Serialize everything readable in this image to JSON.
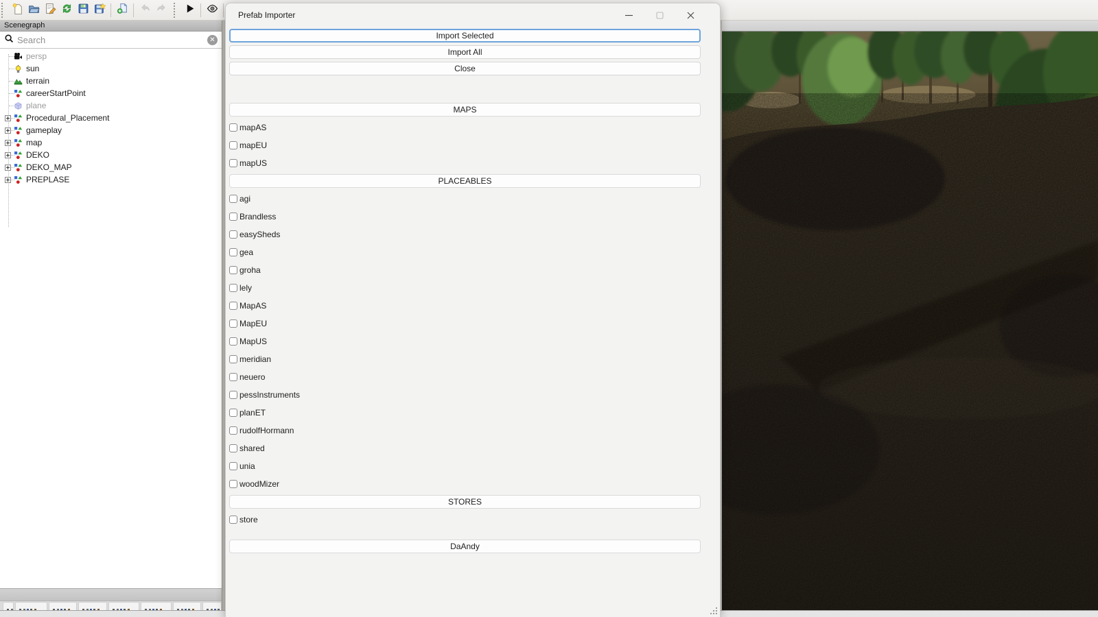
{
  "toolbar": {
    "icons": [
      "new-file",
      "open-file",
      "edit-script",
      "refresh",
      "save",
      "save-as",
      "import-file",
      "undo",
      "redo",
      "play",
      "toggle-visibility",
      "search"
    ]
  },
  "scenegraph": {
    "title": "Scenegraph",
    "search_placeholder": "Search",
    "tree": [
      {
        "label": "persp",
        "icon": "camera",
        "dim": true,
        "expandable": false
      },
      {
        "label": "sun",
        "icon": "light",
        "dim": false,
        "expandable": false
      },
      {
        "label": "terrain",
        "icon": "terrain",
        "dim": false,
        "expandable": false
      },
      {
        "label": "careerStartPoint",
        "icon": "transform-group",
        "dim": false,
        "expandable": false
      },
      {
        "label": "plane",
        "icon": "cube",
        "dim": true,
        "expandable": false
      },
      {
        "label": "Procedural_Placement",
        "icon": "transform-group",
        "dim": false,
        "expandable": true
      },
      {
        "label": "gameplay",
        "icon": "transform-group",
        "dim": false,
        "expandable": true
      },
      {
        "label": "map",
        "icon": "transform-group",
        "dim": false,
        "expandable": true
      },
      {
        "label": "DEKO",
        "icon": "transform-group",
        "dim": false,
        "expandable": true
      },
      {
        "label": "DEKO_MAP",
        "icon": "transform-group",
        "dim": false,
        "expandable": true
      },
      {
        "label": "PREPLASE",
        "icon": "transform-group",
        "dim": false,
        "expandable": true
      }
    ]
  },
  "dialog": {
    "title": "Prefab Importer",
    "window_controls": {
      "minimize": "–",
      "maximize": "",
      "close": "✕"
    },
    "buttons": {
      "import_selected": "Import Selected",
      "import_all": "Import All",
      "close": "Close"
    },
    "sections": {
      "maps": {
        "header": "MAPS",
        "items": [
          "mapAS",
          "mapEU",
          "mapUS"
        ]
      },
      "placeables": {
        "header": "PLACEABLES",
        "items": [
          "agi",
          "Brandless",
          "easySheds",
          "gea",
          "groha",
          "lely",
          "MapAS",
          "MapEU",
          "MapUS",
          "meridian",
          "neuero",
          "pessInstruments",
          "planET",
          "rudolfHormann",
          "shared",
          "unia",
          "woodMizer"
        ]
      },
      "stores": {
        "header": "STORES",
        "items": [
          "store"
        ]
      },
      "daandy": {
        "header": "DaAndy",
        "items": []
      }
    }
  },
  "colors": {
    "accent_focus": "#6da3dc",
    "dialog_bg": "#f3f3f2",
    "panel_header_bg": "#b9b9b9",
    "terrain_brown": "#332c21",
    "tree_green": "#3c5c2e"
  }
}
